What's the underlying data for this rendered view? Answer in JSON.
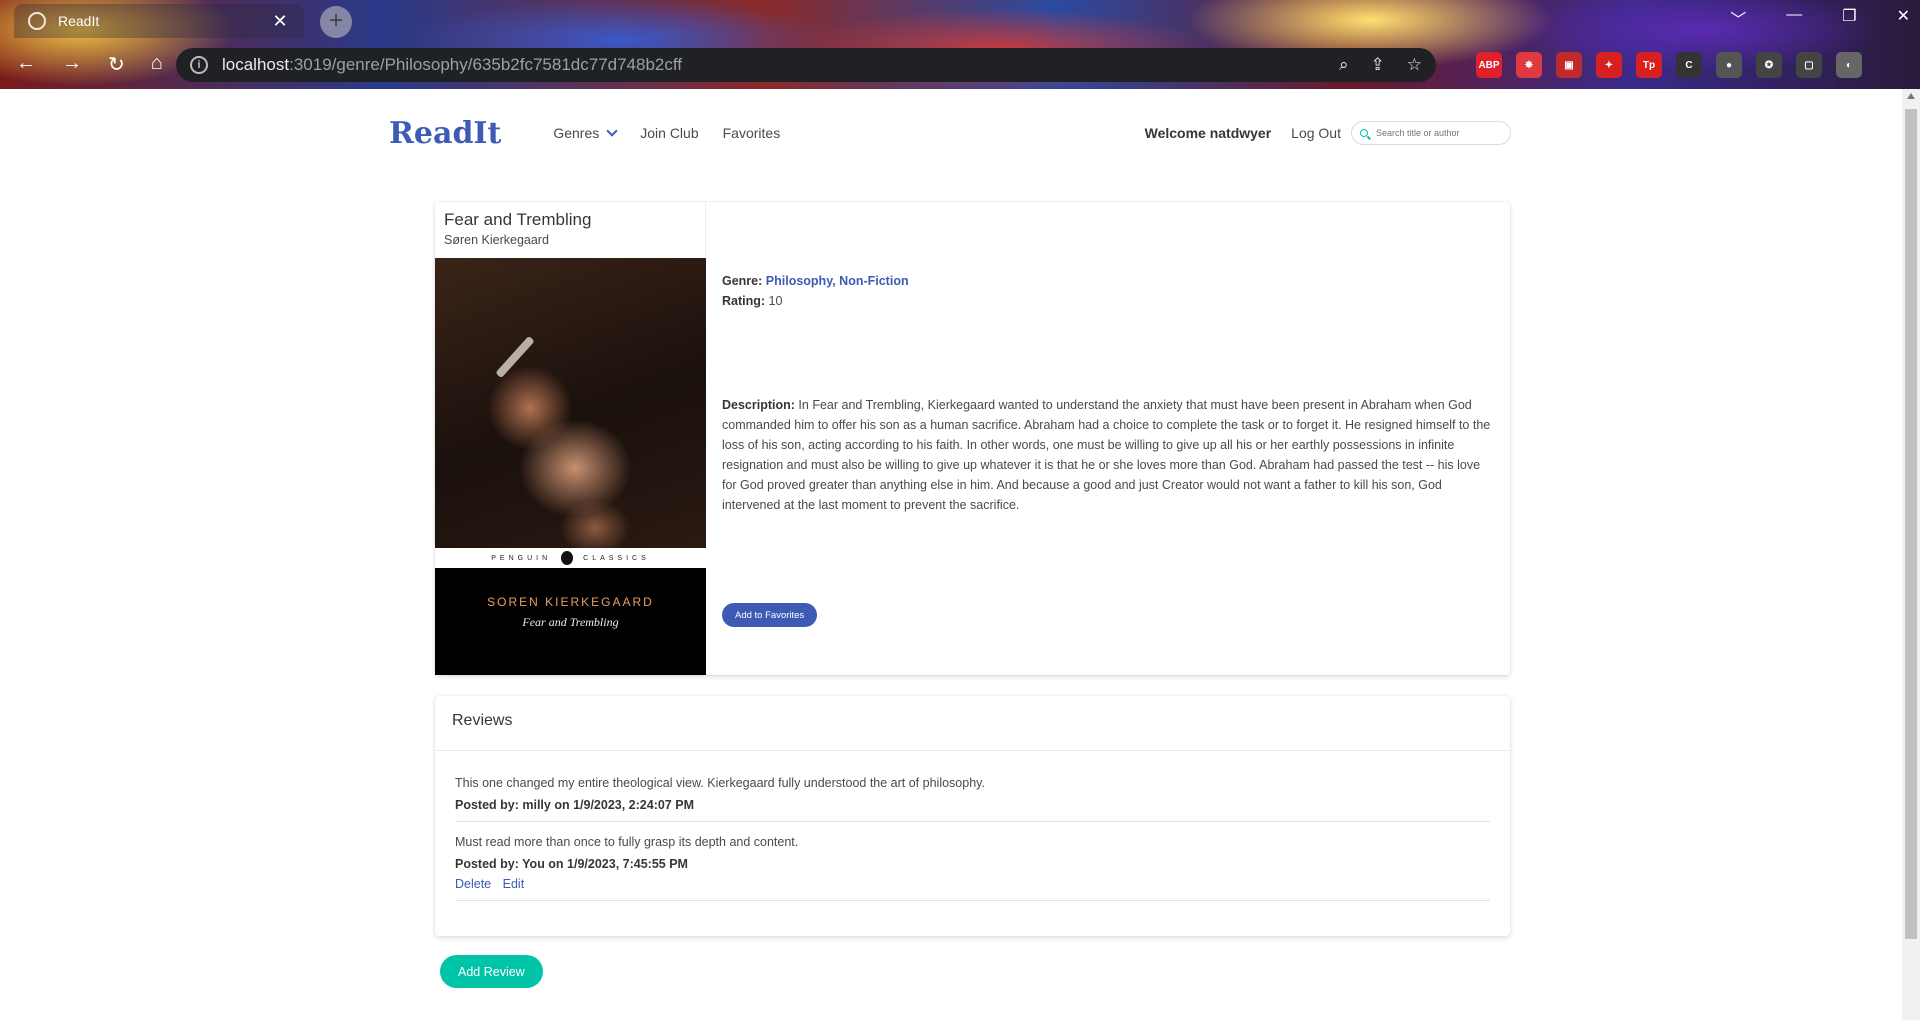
{
  "browser": {
    "tab_title": "ReadIt",
    "tab_close": "✕",
    "new_tab": "+",
    "url_host": "localhost",
    "url_path": ":3019/genre/Philosophy/635b2fc7581dc77d748b2cff",
    "window_buttons": [
      "﹀",
      "—",
      "❐",
      "✕"
    ],
    "nav_buttons": [
      "←",
      "→",
      "↻",
      "⌂"
    ],
    "extensions": [
      {
        "label": "ABP",
        "color": "#e0202a"
      },
      {
        "label": "✸",
        "color": "#e03a40"
      },
      {
        "label": "▣",
        "color": "#c02a2a"
      },
      {
        "label": "✦",
        "color": "#d82020"
      },
      {
        "label": "Tp",
        "color": "#d82020"
      },
      {
        "label": "C",
        "color": "#333333"
      },
      {
        "label": "●",
        "color": "#555555"
      },
      {
        "label": "✪",
        "color": "#444444"
      },
      {
        "label": "▢",
        "color": "#444444"
      },
      {
        "label": "◐",
        "color": "#666666"
      }
    ]
  },
  "nav": {
    "brand": "ReadIt",
    "genres": "Genres",
    "join_club": "Join Club",
    "favorites": "Favorites",
    "welcome": "Welcome natdwyer",
    "logout": "Log Out",
    "search_placeholder": "Search title or author"
  },
  "book": {
    "title": "Fear and Trembling",
    "author": "Søren Kierkegaard",
    "cover_series_left": "PENGUIN",
    "cover_series_right": "CLASSICS",
    "cover_author": "SOREN KIERKEGAARD",
    "cover_title": "Fear and Trembling",
    "genre_label": "Genre:",
    "genre_value": "Philosophy, Non-Fiction",
    "rating_label": "Rating:",
    "rating_value": "10",
    "description_label": "Description:",
    "description": "In Fear and Trembling, Kierkegaard wanted to understand the anxiety that must have been present in Abraham when God commanded him to offer his son as a human sacrifice. Abraham had a choice to complete the task or to forget it. He resigned himself to the loss of his son, acting according to his faith. In other words, one must be willing to give up all his or her earthly possessions in infinite resignation and must also be willing to give up whatever it is that he or she loves more than God. Abraham had passed the test -- his love for God proved greater than anything else in him. And because a good and just Creator would not want a father to kill his son, God intervened at the last moment to prevent the sacrifice.",
    "add_favorites": "Add to Favorites"
  },
  "reviews": {
    "heading": "Reviews",
    "items": [
      {
        "text": "This one changed my entire theological view. Kierkegaard fully understood the art of philosophy.",
        "meta": "Posted by: milly on 1/9/2023, 2:24:07 PM"
      },
      {
        "text": "Must read more than once to fully grasp its depth and content.",
        "meta": "Posted by: You on 1/9/2023, 7:45:55 PM",
        "delete": "Delete",
        "edit": "Edit"
      }
    ],
    "add_review": "Add Review"
  },
  "colors": {
    "brand": "#3d5bb5",
    "accent": "#00c4a7"
  }
}
